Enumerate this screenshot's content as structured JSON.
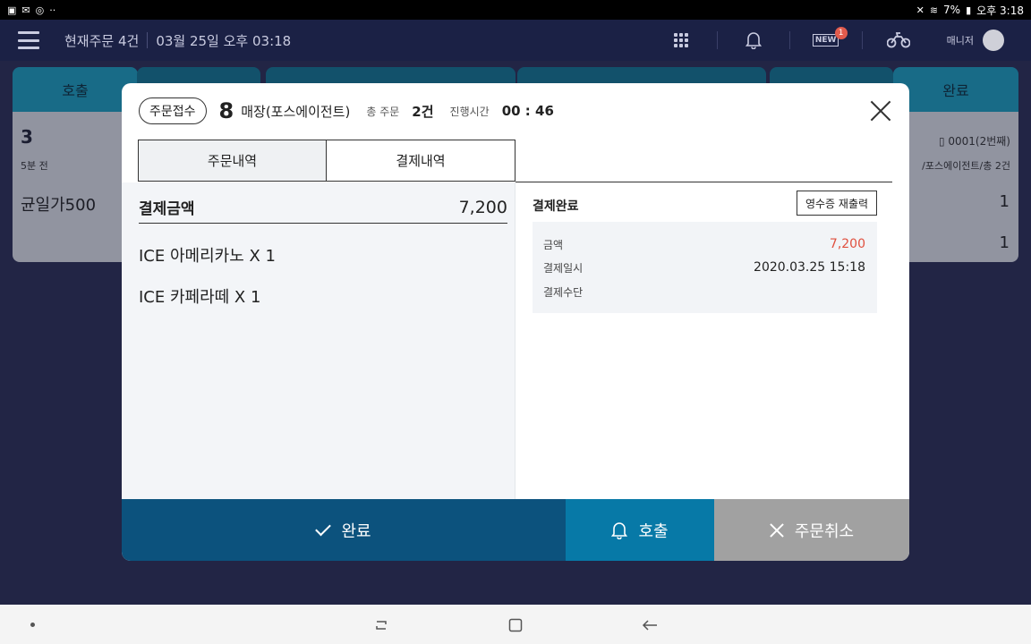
{
  "statusbar": {
    "battery": "7%",
    "time": "오후 3:18"
  },
  "header": {
    "current_orders": "현재주문 4건",
    "datetime": "03월 25일 오후 03:18",
    "new_badge_label": "NEW",
    "new_badge_count": "1",
    "manager_label": "매니저"
  },
  "background": {
    "columns": [
      "호출",
      "완료"
    ],
    "left_card": {
      "number": "3",
      "time": "5분 전",
      "item": "균일가500"
    },
    "right_card": {
      "device": "0001(2번째)",
      "info": "/포스에이전트/총 2건",
      "qty1": "1",
      "qty2": "1"
    }
  },
  "modal": {
    "status": "주문접수",
    "table_number": "8",
    "place": "매장(포스에이전트)",
    "total_label": "총 주문",
    "total_value": "2건",
    "elapsed_label": "진행시간",
    "elapsed_value": "00 : 46",
    "tabs": [
      "주문내역",
      "결제내역"
    ],
    "payment_label": "결제금액",
    "payment_amount": "7,200",
    "items": [
      "ICE 아메리카노  X 1",
      "ICE 카페라떼  X 1"
    ],
    "payment_status": "결제완료",
    "reprint_label": "영수증 재출력",
    "details": {
      "amount_label": "금액",
      "amount_value": "7,200",
      "date_label": "결제일시",
      "date_value": "2020.03.25 15:18",
      "method_label": "결제수단",
      "method_value": ""
    },
    "buttons": {
      "done": "완료",
      "call": "호출",
      "cancel": "주문취소"
    }
  },
  "colors": {
    "done": "#0c527d",
    "call": "#0779a7",
    "cancel": "#a1a1a1",
    "header": "#1b2145",
    "amount_red": "#e0503f"
  }
}
